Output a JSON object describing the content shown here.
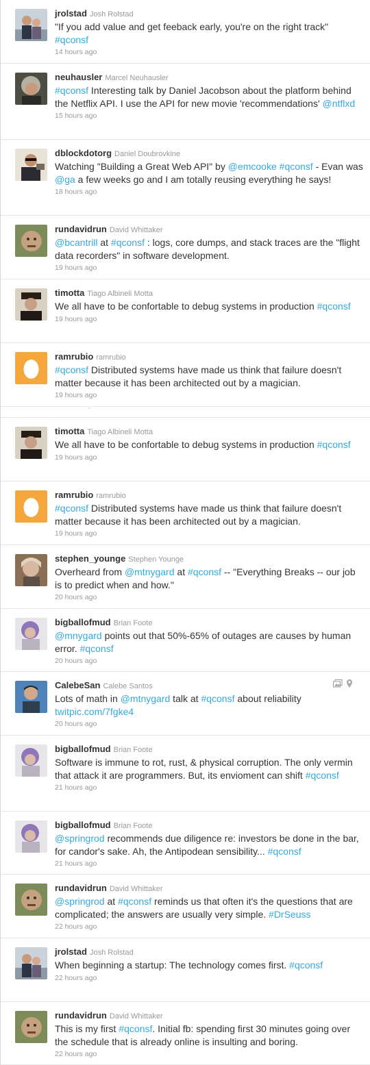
{
  "accent_color": "#33aadd",
  "tweets": [
    {
      "screen_name": "jrolstad",
      "full_name": "Josh Rolstad",
      "avatar": "couple-photo",
      "time": "14 hours ago",
      "parts": [
        {
          "t": "\"If you add value and get feeback early, you're on the right track\" "
        },
        {
          "t": "#qconsf",
          "link": true
        }
      ]
    },
    {
      "screen_name": "neuhausler",
      "full_name": "Marcel Neuhausler",
      "avatar": "man-gray-hair-photo",
      "time": "15 hours ago",
      "parts": [
        {
          "t": "#qconsf",
          "link": true
        },
        {
          "t": " Interesting talk by Daniel Jacobson about the platform behind the Netflix API. I use the API for new movie 'recommendations' "
        },
        {
          "t": "@ntflxd",
          "link": true
        }
      ]
    },
    {
      "screen_name": "dblockdotorg",
      "full_name": "Daniel Doubrovkine",
      "avatar": "man-sunglasses-photo",
      "time": "18 hours ago",
      "parts": [
        {
          "t": "Watching \"Building a Great Web API\" by "
        },
        {
          "t": "@emcooke",
          "link": true
        },
        {
          "t": " "
        },
        {
          "t": "#qconsf",
          "link": true
        },
        {
          "t": " - Evan was "
        },
        {
          "t": "@ga",
          "link": true
        },
        {
          "t": " a few weeks go and I am totally reusing everything he says!"
        }
      ]
    },
    {
      "screen_name": "rundavidrun",
      "full_name": "David Whittaker",
      "avatar": "man-face-photo",
      "time": "19 hours ago",
      "parts": [
        {
          "t": "@bcantrill",
          "link": true
        },
        {
          "t": " at "
        },
        {
          "t": "#qconsf",
          "link": true
        },
        {
          "t": " : logs, core dumps, and stack traces are the \"flight data recorders\" in software development."
        }
      ]
    },
    {
      "screen_name": "timotta",
      "full_name": "Tiago Albineli Motta",
      "avatar": "man-hat-photo",
      "time": "19 hours ago",
      "parts": [
        {
          "t": "We all have to be confortable to debug systems in production "
        },
        {
          "t": "#qconsf",
          "link": true
        }
      ]
    },
    {
      "screen_name": "ramrubio",
      "full_name": "ramrubio",
      "avatar": "default-egg",
      "time": "19 hours ago",
      "parts": [
        {
          "t": "#qconsf",
          "link": true
        },
        {
          "t": " Distributed systems have made us think that failure doesn't matter because it has been architected out by a magician."
        }
      ]
    },
    {
      "gap": true,
      "gap_mark": "ˇ"
    },
    {
      "screen_name": "timotta",
      "full_name": "Tiago Albineli Motta",
      "avatar": "man-hat-photo",
      "time": "19 hours ago",
      "parts": [
        {
          "t": "We all have to be confortable to debug systems in production "
        },
        {
          "t": "#qconsf",
          "link": true
        }
      ]
    },
    {
      "screen_name": "ramrubio",
      "full_name": "ramrubio",
      "avatar": "default-egg",
      "time": "19 hours ago",
      "parts": [
        {
          "t": "#qconsf",
          "link": true
        },
        {
          "t": " Distributed systems have made us think that failure doesn't matter because it has been architected out by a magician."
        }
      ]
    },
    {
      "screen_name": "stephen_younge",
      "full_name": "Stephen Younge",
      "avatar": "woman-photo",
      "time": "20 hours ago",
      "parts": [
        {
          "t": "Overheard from "
        },
        {
          "t": "@mtnygard",
          "link": true
        },
        {
          "t": " at "
        },
        {
          "t": "#qconsf",
          "link": true
        },
        {
          "t": " -- \"Everything Breaks -- our job is to predict when and how.\""
        }
      ]
    },
    {
      "screen_name": "bigballofmud",
      "full_name": "Brian Foote",
      "avatar": "purple-hair-photo",
      "time": "20 hours ago",
      "parts": [
        {
          "t": "@mnygard",
          "link": true
        },
        {
          "t": " points out that 50%-65% of outages are causes by human error. "
        },
        {
          "t": "#qconsf",
          "link": true
        }
      ]
    },
    {
      "screen_name": "CalebeSan",
      "full_name": "Calebe Santos",
      "avatar": "young-man-photo",
      "time": "20 hours ago",
      "media": true,
      "parts": [
        {
          "t": "Lots of math in "
        },
        {
          "t": "@mtnygard",
          "link": true
        },
        {
          "t": " talk at "
        },
        {
          "t": "#qconsf",
          "link": true
        },
        {
          "t": " about reliability "
        },
        {
          "t": "twitpic.com/7fgke4",
          "link": true
        }
      ]
    },
    {
      "screen_name": "bigballofmud",
      "full_name": "Brian Foote",
      "avatar": "purple-hair-photo",
      "time": "21 hours ago",
      "parts": [
        {
          "t": "Software is immune to rot, rust, & physical corruption. The only vermin that attack it are programmers. But, its envioment can shift "
        },
        {
          "t": "#qconsf",
          "link": true
        }
      ]
    },
    {
      "screen_name": "bigballofmud",
      "full_name": "Brian Foote",
      "avatar": "purple-hair-photo",
      "time": "21 hours ago",
      "parts": [
        {
          "t": "@springrod",
          "link": true
        },
        {
          "t": " recommends due diligence re: investors be done in the bar, for candor's sake. Ah, the Antipodean sensibility... "
        },
        {
          "t": "#qconsf",
          "link": true
        }
      ]
    },
    {
      "screen_name": "rundavidrun",
      "full_name": "David Whittaker",
      "avatar": "man-face-photo",
      "time": "22 hours ago",
      "parts": [
        {
          "t": "@springrod",
          "link": true
        },
        {
          "t": " at "
        },
        {
          "t": "#qconsf",
          "link": true
        },
        {
          "t": " reminds us that often it's the questions that are complicated; the answers are usually very simple. "
        },
        {
          "t": "#DrSeuss",
          "link": true
        }
      ]
    },
    {
      "screen_name": "jrolstad",
      "full_name": "Josh Rolstad",
      "avatar": "couple-photo",
      "time": "22 hours ago",
      "parts": [
        {
          "t": "When beginning a startup: The technology comes first. "
        },
        {
          "t": "#qconsf",
          "link": true
        }
      ]
    },
    {
      "screen_name": "rundavidrun",
      "full_name": "David Whittaker",
      "avatar": "man-face-photo",
      "time": "22 hours ago",
      "parts": [
        {
          "t": "This is my first "
        },
        {
          "t": "#qconsf",
          "link": true
        },
        {
          "t": ". Initial fb: spending first 30 minutes going over the schedule that is already online is insulting and boring."
        }
      ]
    }
  ]
}
